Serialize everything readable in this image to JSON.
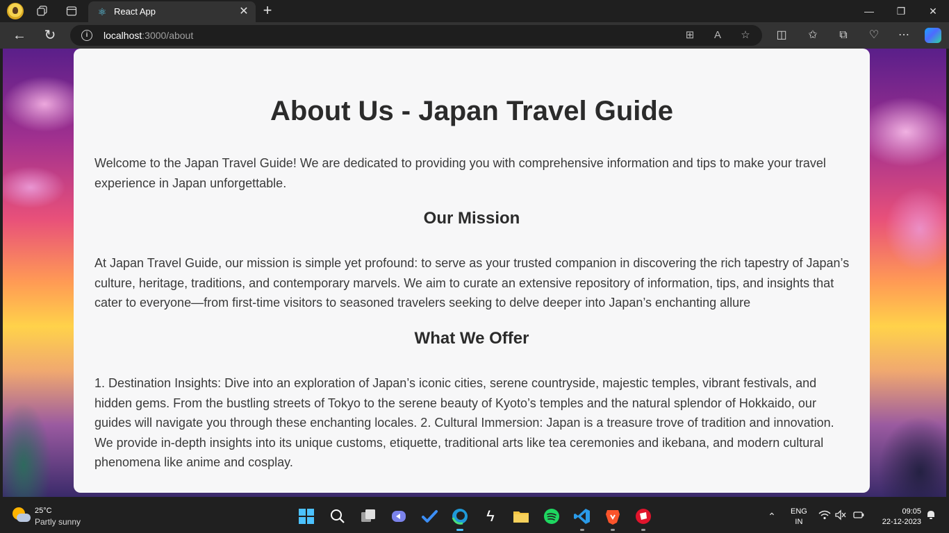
{
  "browser": {
    "tab_title": "React App",
    "url_host": "localhost",
    "url_path": ":3000/about"
  },
  "page": {
    "title": "About Us - Japan Travel Guide",
    "intro": "Welcome to the Japan Travel Guide! We are dedicated to providing you with comprehensive information and tips to make your travel experience in Japan unforgettable.",
    "sections": [
      {
        "heading": "Our Mission",
        "body": "At Japan Travel Guide, our mission is simple yet profound: to serve as your trusted companion in discovering the rich tapestry of Japan’s culture, heritage, traditions, and contemporary marvels. We aim to curate an extensive repository of information, tips, and insights that cater to everyone—from first-time visitors to seasoned travelers seeking to delve deeper into Japan’s enchanting allure"
      },
      {
        "heading": "What We Offer",
        "body": "1. Destination Insights: Dive into an exploration of Japan’s iconic cities, serene countryside, majestic temples, vibrant festivals, and hidden gems. From the bustling streets of Tokyo to the serene beauty of Kyoto’s temples and the natural splendor of Hokkaido, our guides will navigate you through these enchanting locales. 2. Cultural Immersion: Japan is a treasure trove of tradition and innovation. We provide in-depth insights into its unique customs, etiquette, traditional arts like tea ceremonies and ikebana, and modern cultural phenomena like anime and cosplay."
      }
    ]
  },
  "taskbar": {
    "weather_temp": "25°C",
    "weather_desc": "Partly sunny",
    "lang_line1": "ENG",
    "lang_line2": "IN",
    "time": "09:05",
    "date": "22-12-2023"
  },
  "colors": {
    "page_card_bg": "#f7f7f8",
    "text": "#333333",
    "edge_active": "#4cc2ff"
  }
}
